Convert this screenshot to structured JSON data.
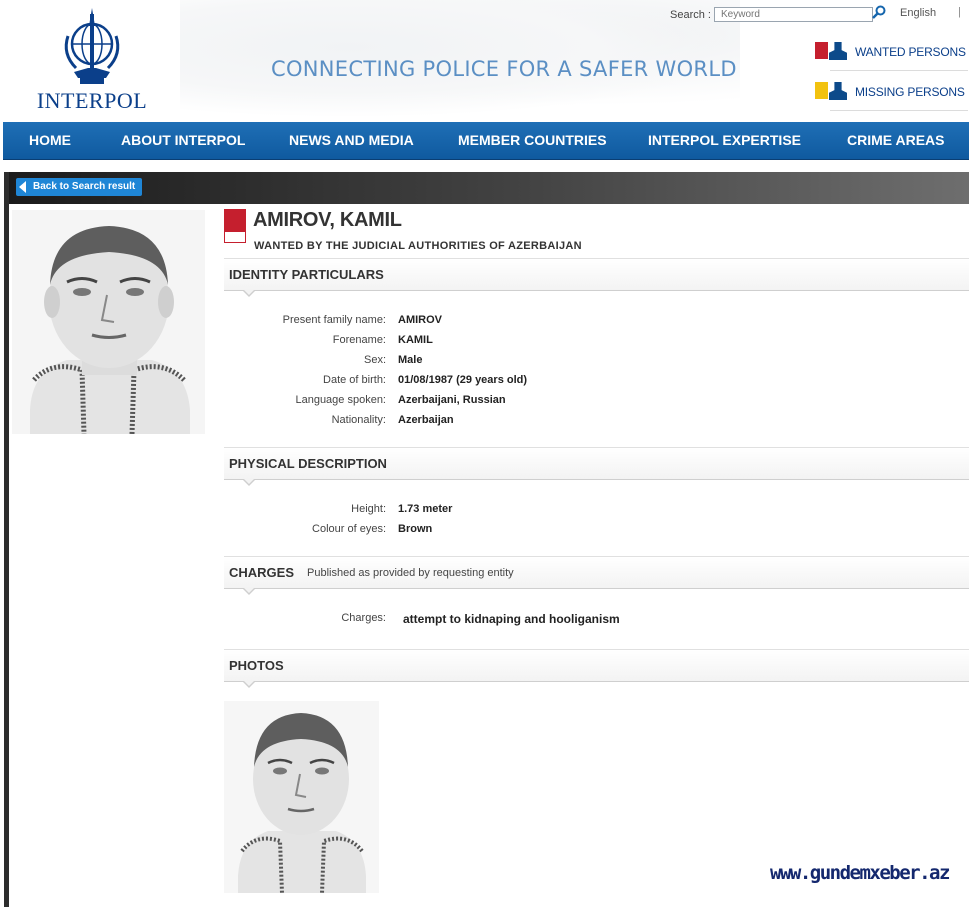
{
  "header": {
    "logo_text": "INTERPOL",
    "tagline": "CONNECTING POLICE FOR A SAFER WORLD",
    "search_label": "Search :",
    "search_placeholder": "Keyword",
    "language": "English",
    "language_separator": "|",
    "wanted_link": "WANTED PERSONS",
    "missing_link": "MISSING PERSONS",
    "brand_color": "#0b3f8a"
  },
  "nav": {
    "items": [
      "HOME",
      "ABOUT INTERPOL",
      "NEWS AND MEDIA",
      "MEMBER COUNTRIES",
      "INTERPOL EXPERTISE",
      "CRIME AREAS"
    ],
    "color": "#1666ad"
  },
  "back_button": "Back to Search result",
  "person": {
    "name": "AMIROV, KAMIL",
    "wanted_by": "WANTED BY THE JUDICIAL AUTHORITIES OF AZERBAIJAN"
  },
  "identity": {
    "title": "IDENTITY PARTICULARS",
    "rows": [
      {
        "label": "Present family name:",
        "value": "AMIROV"
      },
      {
        "label": "Forename:",
        "value": "KAMIL"
      },
      {
        "label": "Sex:",
        "value": "Male"
      },
      {
        "label": "Date of birth:",
        "value": "01/08/1987 (29 years old)"
      },
      {
        "label": "Language spoken:",
        "value": "Azerbaijani, Russian"
      },
      {
        "label": "Nationality:",
        "value": "Azerbaijan"
      }
    ]
  },
  "physical": {
    "title": "PHYSICAL DESCRIPTION",
    "rows": [
      {
        "label": "Height:",
        "value": "1.73 meter"
      },
      {
        "label": "Colour of eyes:",
        "value": "Brown"
      }
    ]
  },
  "charges": {
    "title": "CHARGES",
    "subtitle": "Published as provided by requesting entity",
    "label": "Charges:",
    "value": "attempt to kidnaping and hooliganism"
  },
  "photos": {
    "title": "PHOTOS"
  },
  "watermark": "www.gundemxeber.az"
}
